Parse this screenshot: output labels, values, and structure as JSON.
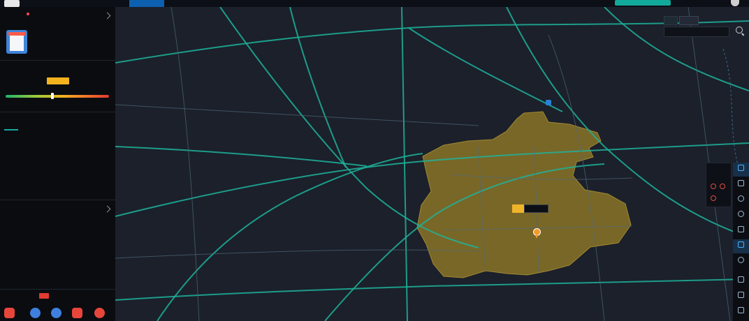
{
  "colors": {
    "brand_blue": "#0d5fb0",
    "accent_teal": "#17a9a0",
    "road_green": "#1db39a",
    "congestion_zone": "#8a7428",
    "alert_red": "#ff4b4b",
    "gauge_gradient": [
      "#1fb46a",
      "#9fc93a",
      "#f2b31f",
      "#f2752b",
      "#e23a30"
    ]
  },
  "icons": {
    "logo": "amap-logo-icon",
    "chevron": "chevron-right-icon",
    "search": "search-icon",
    "filter": "filter-dot-icon",
    "poi": "map-pin-icon",
    "station": "train-station-icon",
    "avatar": "user-avatar-icon"
  },
  "status": {
    "congestion_gauge_fraction": 0.45
  }
}
